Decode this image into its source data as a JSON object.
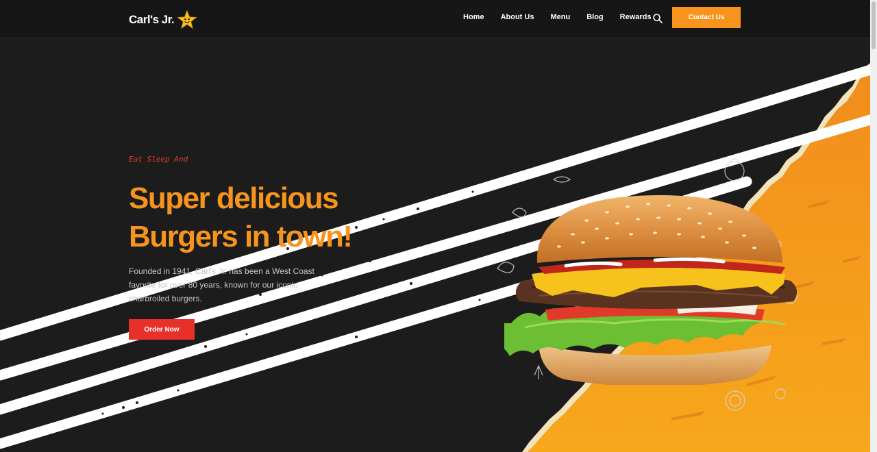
{
  "header": {
    "logo_text": "Carl's Jr.",
    "nav": [
      "Home",
      "About Us",
      "Menu",
      "Blog",
      "Rewards"
    ],
    "contact_label": "Contact Us"
  },
  "hero": {
    "tagline": "Eat Sleep And",
    "headline_line1": "Super delicious",
    "headline_line2": "Burgers in town!",
    "description": "Founded in 1941, Carl's Jr. has been a West Coast favorite for over 80 years, known for our iconic charbroiled burgers.",
    "order_label": "Order Now"
  },
  "icons": {
    "logo": "star-icon",
    "search": "search-icon"
  },
  "colors": {
    "accent_orange": "#f7941d",
    "cta_red": "#e8302a",
    "background": "#1c1c1c",
    "tagline_red": "#e23b2b",
    "stripe_white": "#ffffff"
  }
}
